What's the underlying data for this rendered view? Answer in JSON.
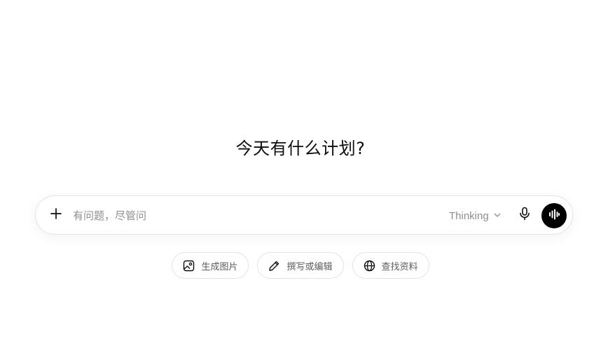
{
  "heading": "今天有什么计划?",
  "composer": {
    "placeholder": "有问题，尽管问",
    "model_label": "Thinking",
    "icons": {
      "add": "plus-icon",
      "model_dropdown": "chevron-down-icon",
      "dictate": "microphone-icon",
      "voice": "voice-waveform-icon"
    }
  },
  "suggestions": [
    {
      "label": "生成图片",
      "icon": "image-icon"
    },
    {
      "label": "撰写或编辑",
      "icon": "pencil-icon"
    },
    {
      "label": "查找资料",
      "icon": "globe-icon"
    }
  ],
  "colors": {
    "background": "#ffffff",
    "text": "#0d0d0d",
    "muted": "#8f8f8f",
    "border": "#e3e3e3",
    "voice_button": "#000000"
  }
}
